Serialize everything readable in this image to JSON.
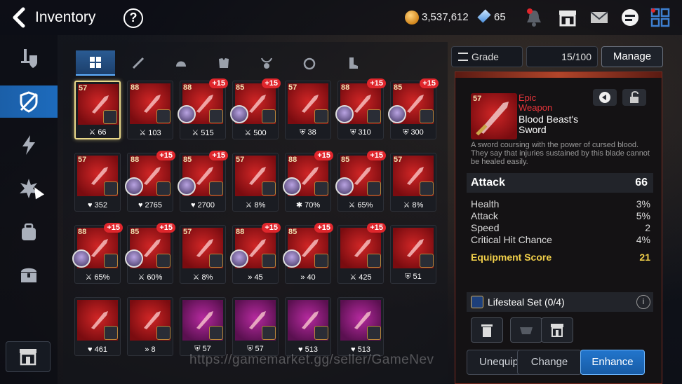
{
  "header": {
    "title": "Inventory",
    "gold": "3,537,612",
    "skystone": "65"
  },
  "filters": {
    "grade_label": "Grade",
    "capacity": "15/100",
    "manage_label": "Manage"
  },
  "tabs": [
    "all",
    "weapon",
    "helmet",
    "armor",
    "necklace",
    "ring",
    "boots"
  ],
  "items": [
    {
      "lvl": "57",
      "plus": "",
      "stat": "66",
      "stat_icon": "attack",
      "owner": false,
      "heroic": false,
      "selected": true
    },
    {
      "lvl": "88",
      "plus": "",
      "stat": "103",
      "stat_icon": "attack",
      "owner": false,
      "heroic": false,
      "selected": false
    },
    {
      "lvl": "88",
      "plus": "+15",
      "stat": "515",
      "stat_icon": "attack",
      "owner": true,
      "heroic": false,
      "selected": false
    },
    {
      "lvl": "85",
      "plus": "+15",
      "stat": "500",
      "stat_icon": "attack",
      "owner": true,
      "heroic": false,
      "selected": false
    },
    {
      "lvl": "57",
      "plus": "",
      "stat": "38",
      "stat_icon": "defense",
      "owner": false,
      "heroic": false,
      "selected": false
    },
    {
      "lvl": "88",
      "plus": "+15",
      "stat": "310",
      "stat_icon": "defense",
      "owner": true,
      "heroic": false,
      "selected": false
    },
    {
      "lvl": "85",
      "plus": "+15",
      "stat": "300",
      "stat_icon": "defense",
      "owner": true,
      "heroic": false,
      "selected": false
    },
    {
      "lvl": "57",
      "plus": "",
      "stat": "352",
      "stat_icon": "health",
      "owner": false,
      "heroic": false,
      "selected": false
    },
    {
      "lvl": "88",
      "plus": "+15",
      "stat": "2765",
      "stat_icon": "health",
      "owner": true,
      "heroic": false,
      "selected": false
    },
    {
      "lvl": "85",
      "plus": "+15",
      "stat": "2700",
      "stat_icon": "health",
      "owner": true,
      "heroic": false,
      "selected": false
    },
    {
      "lvl": "57",
      "plus": "",
      "stat": "8%",
      "stat_icon": "attack",
      "owner": false,
      "heroic": false,
      "selected": false
    },
    {
      "lvl": "88",
      "plus": "+15",
      "stat": "70%",
      "stat_icon": "crit",
      "owner": true,
      "heroic": false,
      "selected": false
    },
    {
      "lvl": "85",
      "plus": "+15",
      "stat": "65%",
      "stat_icon": "attack",
      "owner": true,
      "heroic": false,
      "selected": false
    },
    {
      "lvl": "57",
      "plus": "",
      "stat": "8%",
      "stat_icon": "attack",
      "owner": false,
      "heroic": false,
      "selected": false
    },
    {
      "lvl": "88",
      "plus": "+15",
      "stat": "65%",
      "stat_icon": "attack",
      "owner": true,
      "heroic": false,
      "selected": false
    },
    {
      "lvl": "85",
      "plus": "+15",
      "stat": "60%",
      "stat_icon": "attack",
      "owner": true,
      "heroic": false,
      "selected": false
    },
    {
      "lvl": "57",
      "plus": "",
      "stat": "8%",
      "stat_icon": "attack",
      "owner": false,
      "heroic": false,
      "selected": false
    },
    {
      "lvl": "88",
      "plus": "+15",
      "stat": "45",
      "stat_icon": "speed",
      "owner": true,
      "heroic": false,
      "selected": false
    },
    {
      "lvl": "85",
      "plus": "+15",
      "stat": "40",
      "stat_icon": "speed",
      "owner": true,
      "heroic": false,
      "selected": false
    },
    {
      "lvl": "",
      "plus": "+15",
      "stat": "425",
      "stat_icon": "attack",
      "owner": false,
      "heroic": false,
      "selected": false
    },
    {
      "lvl": "",
      "plus": "",
      "stat": "51",
      "stat_icon": "defense",
      "owner": false,
      "heroic": false,
      "selected": false
    },
    {
      "lvl": "",
      "plus": "",
      "stat": "461",
      "stat_icon": "health",
      "owner": false,
      "heroic": false,
      "selected": false
    },
    {
      "lvl": "",
      "plus": "",
      "stat": "8",
      "stat_icon": "speed",
      "owner": false,
      "heroic": false,
      "selected": false
    },
    {
      "lvl": "",
      "plus": "",
      "stat": "57",
      "stat_icon": "defense",
      "owner": false,
      "heroic": true,
      "selected": false
    },
    {
      "lvl": "",
      "plus": "",
      "stat": "57",
      "stat_icon": "defense",
      "owner": false,
      "heroic": true,
      "selected": false
    },
    {
      "lvl": "",
      "plus": "",
      "stat": "513",
      "stat_icon": "health",
      "owner": false,
      "heroic": true,
      "selected": false
    },
    {
      "lvl": "",
      "plus": "",
      "stat": "513",
      "stat_icon": "health",
      "owner": false,
      "heroic": true,
      "selected": false
    }
  ],
  "detail": {
    "level": "57",
    "grade_line1": "Epic",
    "grade_line2": "Weapon",
    "name_line1": "Blood Beast's",
    "name_line2": "Sword",
    "description": "A sword coursing with the power of cursed blood. They say that injuries sustained by this blade cannot be healed easily.",
    "main_stat": {
      "label": "Attack",
      "value": "66"
    },
    "sub_stats": [
      {
        "label": "Health",
        "value": "3%"
      },
      {
        "label": "Attack",
        "value": "5%"
      },
      {
        "label": "Speed",
        "value": "2"
      },
      {
        "label": "Critical Hit Chance",
        "value": "4%"
      }
    ],
    "score_label": "Equipment Score",
    "score_value": "21",
    "set_label": "Lifesteal Set (0/4)",
    "buttons": {
      "unequip": "Unequip",
      "change": "Change",
      "enhance": "Enhance"
    }
  },
  "watermark": "https://gamemarket.gg/seller/GameNev",
  "colors": {
    "accent": "#1d6bbd",
    "epic": "#e8353b",
    "score": "#f2d04a",
    "plus_badge": "#e0262c"
  }
}
